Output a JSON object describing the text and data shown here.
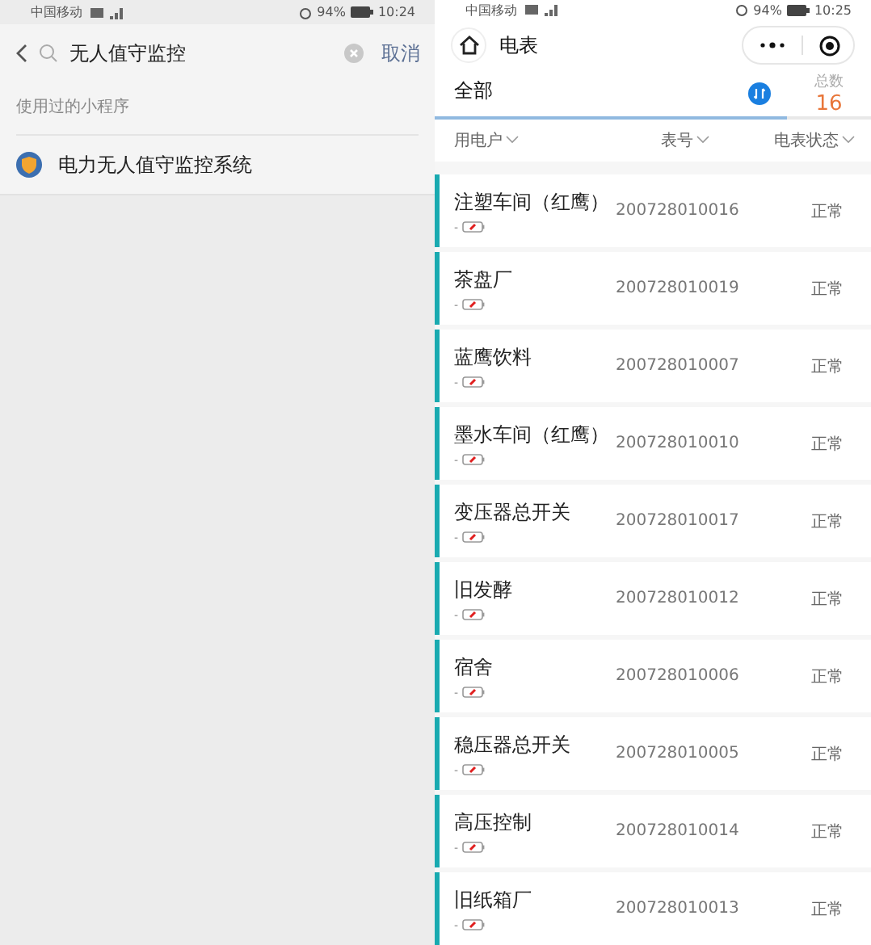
{
  "left": {
    "status_bar": {
      "carrier": "中国移动",
      "battery": "94%",
      "time": "10:24"
    },
    "search": {
      "value": "无人值守监控",
      "cancel": "取消"
    },
    "section_label": "使用过的小程序",
    "results": [
      {
        "title": "电力无人值守监控系统"
      }
    ]
  },
  "right": {
    "status_bar": {
      "carrier": "中国移动",
      "battery": "94%",
      "time": "10:25"
    },
    "nav": {
      "title": "电表"
    },
    "tabs": [
      {
        "label": "全部",
        "selected": true
      }
    ],
    "total": {
      "label": "总数",
      "value": "16"
    },
    "columns": [
      "用电户",
      "表号",
      "电表状态"
    ],
    "rows": [
      {
        "name": "注塑车间（红鹰）",
        "prefix": "-",
        "meter": "200728010016",
        "status": "正常"
      },
      {
        "name": "茶盘厂",
        "prefix": "-",
        "meter": "200728010019",
        "status": "正常"
      },
      {
        "name": "蓝鹰饮料",
        "prefix": "-",
        "meter": "200728010007",
        "status": "正常"
      },
      {
        "name": "墨水车间（红鹰）",
        "prefix": "-",
        "meter": "200728010010",
        "status": "正常"
      },
      {
        "name": "变压器总开关",
        "prefix": "-",
        "meter": "200728010017",
        "status": "正常"
      },
      {
        "name": "旧发酵",
        "prefix": "-",
        "meter": "200728010012",
        "status": "正常"
      },
      {
        "name": "宿舍",
        "prefix": "-",
        "meter": "200728010006",
        "status": "正常"
      },
      {
        "name": "稳压器总开关",
        "prefix": "-",
        "meter": "200728010005",
        "status": "正常"
      },
      {
        "name": "高压控制",
        "prefix": "-",
        "meter": "200728010014",
        "status": "正常"
      },
      {
        "name": "旧纸箱厂",
        "prefix": "-",
        "meter": "200728010013",
        "status": "正常"
      }
    ]
  }
}
